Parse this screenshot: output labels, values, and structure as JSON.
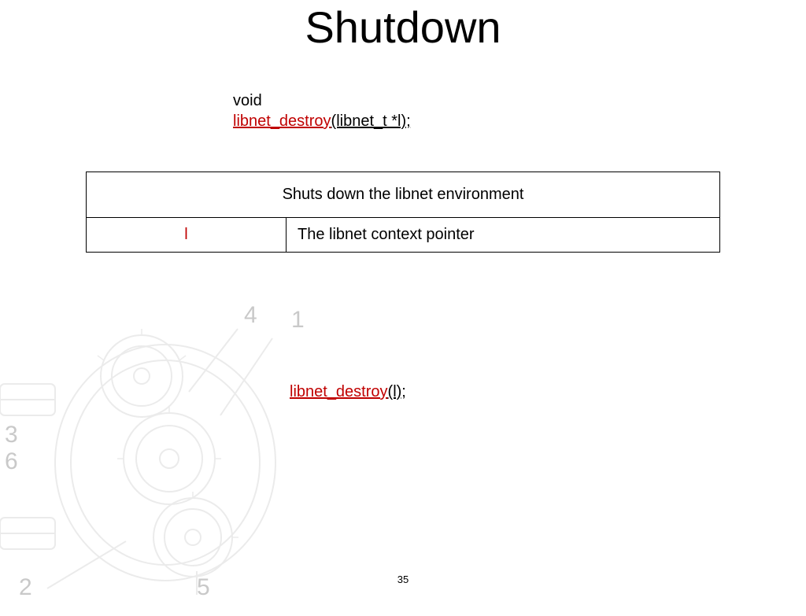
{
  "title": "Shutdown",
  "signature": {
    "return_type": "void",
    "function": "libnet_destroy",
    "params": "(libnet_t *l);"
  },
  "description": "Shuts down the libnet environment",
  "param_row": {
    "name": "l",
    "desc": "The libnet context pointer"
  },
  "call_example": {
    "function": "libnet_destroy",
    "args": "(l);"
  },
  "page_number": "35",
  "decor_numbers": {
    "n1": "1",
    "n2": "2",
    "n3": "3",
    "n4": "4",
    "n5": "5",
    "n6": "6"
  }
}
